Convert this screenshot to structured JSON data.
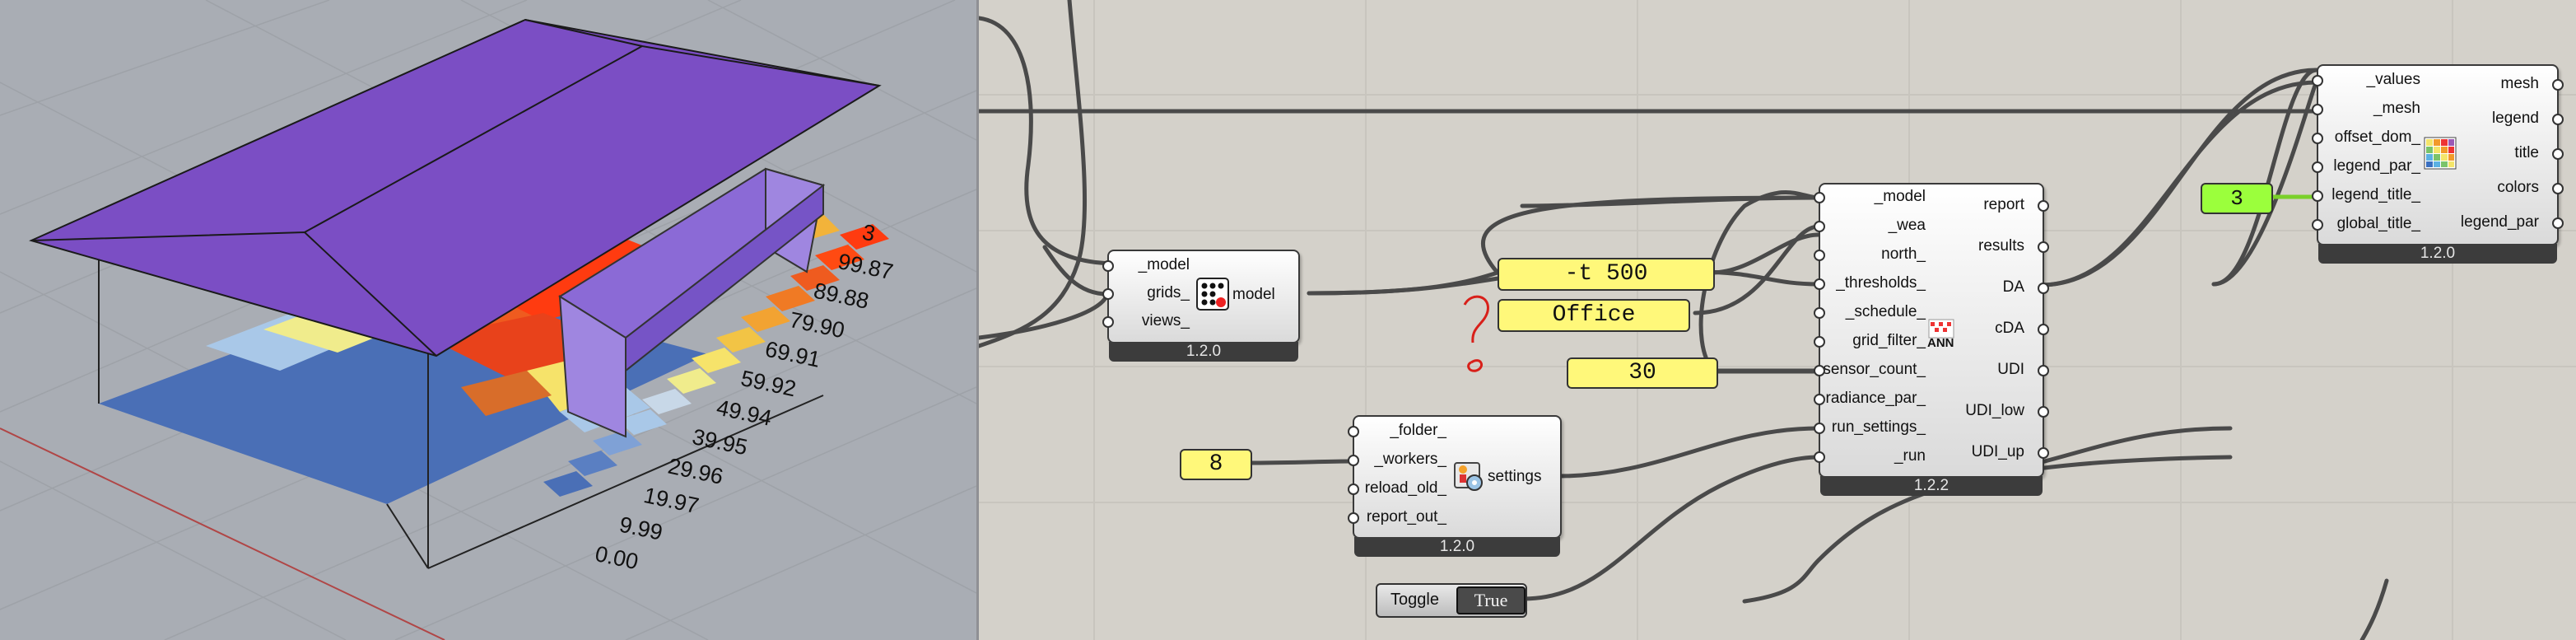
{
  "viewport": {
    "legend_values": [
      "3",
      "99.87",
      "89.88",
      "79.90",
      "69.91",
      "59.92",
      "49.94",
      "39.95",
      "29.96",
      "19.97",
      "9.99",
      "0.00"
    ],
    "colors": {
      "roof": "#7b4ec4",
      "background": "#a9adb4"
    }
  },
  "canvas": {
    "model_component": {
      "inputs": [
        "_model",
        "grids_",
        "views_"
      ],
      "output": "model",
      "version": "1.2.0"
    },
    "settings_component": {
      "inputs": [
        "_folder_",
        "_workers_",
        "reload_old_",
        "report_out_"
      ],
      "output": "settings",
      "version": "1.2.0"
    },
    "annual_component": {
      "inputs": [
        "_model",
        "_wea",
        "north_",
        "_thresholds_",
        "_schedule_",
        "grid_filter_",
        "sensor_count_",
        "radiance_par_",
        "run_settings_",
        "_run"
      ],
      "outputs": [
        "report",
        "results",
        "DA",
        "cDA",
        "UDI",
        "UDI_low",
        "UDI_up"
      ],
      "version": "1.2.2",
      "icon_text": "ANN"
    },
    "legend_component": {
      "inputs": [
        "_values",
        "_mesh",
        "offset_dom_",
        "legend_par_",
        "legend_title_",
        "global_title_"
      ],
      "outputs": [
        "mesh",
        "legend",
        "title",
        "colors",
        "legend_par"
      ],
      "version": "1.2.0"
    },
    "panels": {
      "thresholds": "-t 500",
      "schedule": "Office",
      "sensor_count": "30",
      "workers": "8"
    },
    "number_slider": "3",
    "toggle": {
      "label": "Toggle",
      "value": "True"
    }
  }
}
